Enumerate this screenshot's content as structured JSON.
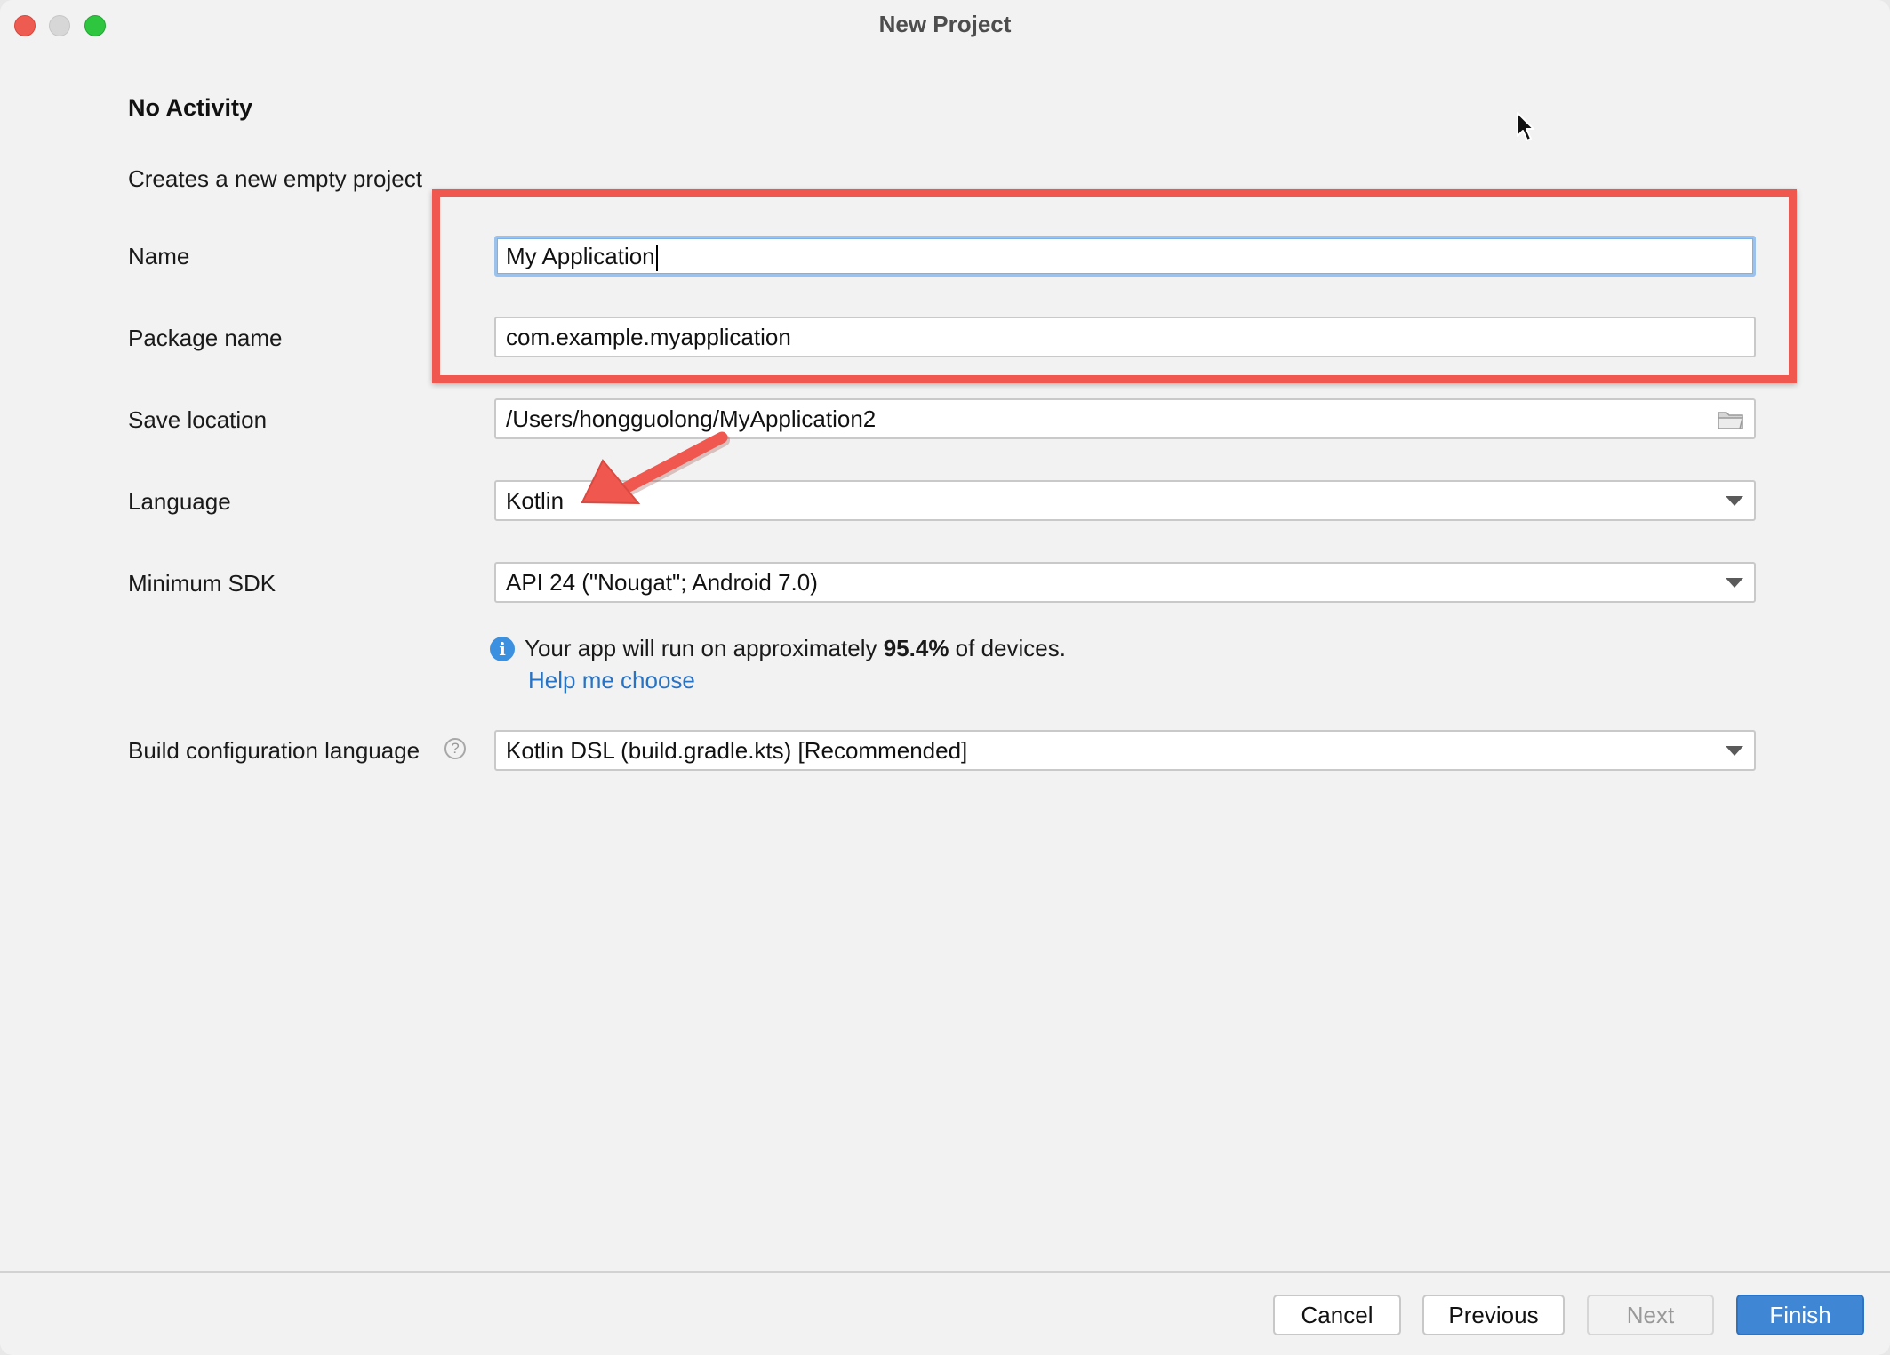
{
  "window": {
    "title": "New Project"
  },
  "page": {
    "heading": "No Activity",
    "description": "Creates a new empty project"
  },
  "form": {
    "name": {
      "label": "Name",
      "value": "My Application"
    },
    "package_name": {
      "label": "Package name",
      "value": "com.example.myapplication"
    },
    "save_location": {
      "label": "Save location",
      "value": "/Users/hongguolong/MyApplication2",
      "icon": "folder-icon"
    },
    "language": {
      "label": "Language",
      "value": "Kotlin"
    },
    "minimum_sdk": {
      "label": "Minimum SDK",
      "value": "API 24 (\"Nougat\"; Android 7.0)"
    },
    "sdk_info": {
      "icon": "info-icon",
      "prefix": "Your app will run on approximately ",
      "percent": "95.4%",
      "suffix": " of devices.",
      "help_link": "Help me choose"
    },
    "build_config_language": {
      "label": "Build configuration language",
      "help_icon": "?",
      "value": "Kotlin DSL (build.gradle.kts) [Recommended]"
    }
  },
  "buttons": {
    "cancel": "Cancel",
    "previous": "Previous",
    "next": "Next",
    "finish": "Finish"
  },
  "colors": {
    "annotation": "#f0574e",
    "link": "#2873c4",
    "primary_button": "#3f86d4",
    "focus_ring": "#9cc2ec"
  }
}
